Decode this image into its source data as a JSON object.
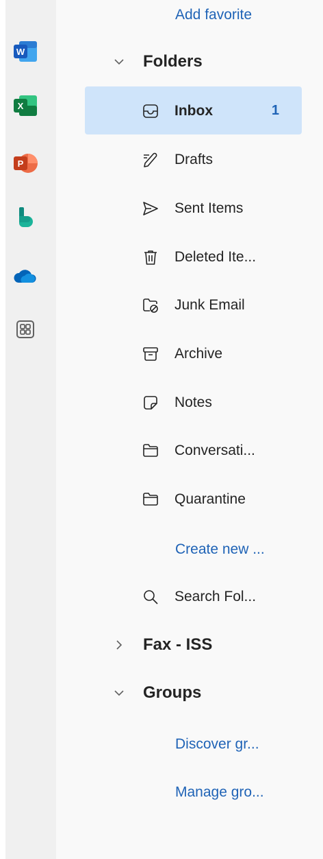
{
  "apps": [
    {
      "name": "Word",
      "letter": "W",
      "color": "#185abd"
    },
    {
      "name": "Excel",
      "letter": "X",
      "color": "#107c41"
    },
    {
      "name": "PowerPoint",
      "letter": "P",
      "color": "#c43e1c"
    },
    {
      "name": "Bookings",
      "color": "#0f8a7e"
    },
    {
      "name": "OneDrive",
      "color": "#0364b8"
    },
    {
      "name": "More apps",
      "color": "#616161"
    }
  ],
  "favorites": {
    "add_label": "Add favorite"
  },
  "folders_section": {
    "label": "Folders"
  },
  "folders": [
    {
      "name": "Inbox",
      "count": "1",
      "icon": "inbox-icon",
      "selected": true
    },
    {
      "name": "Drafts",
      "icon": "pencil-icon"
    },
    {
      "name": "Sent Items",
      "icon": "send-icon"
    },
    {
      "name": "Deleted Ite...",
      "icon": "trash-icon"
    },
    {
      "name": "Junk Email",
      "icon": "junk-folder-icon"
    },
    {
      "name": "Archive",
      "icon": "archive-icon"
    },
    {
      "name": "Notes",
      "icon": "note-icon"
    },
    {
      "name": "Conversati...",
      "icon": "folder-icon"
    },
    {
      "name": "Quarantine",
      "icon": "folder-icon"
    },
    {
      "name": "Search Fol...",
      "icon": "search-icon"
    }
  ],
  "create_new_label": "Create new ...",
  "fax_section": {
    "label": "Fax - ISS"
  },
  "groups_section": {
    "label": "Groups"
  },
  "groups": {
    "discover_label": "Discover gr...",
    "manage_label": "Manage gro..."
  },
  "colors": {
    "accent": "#1f63b6",
    "selected_bg": "#cfe4fa",
    "rail_bg": "#f0f0f0",
    "pane_bg": "#f9f9f9"
  }
}
